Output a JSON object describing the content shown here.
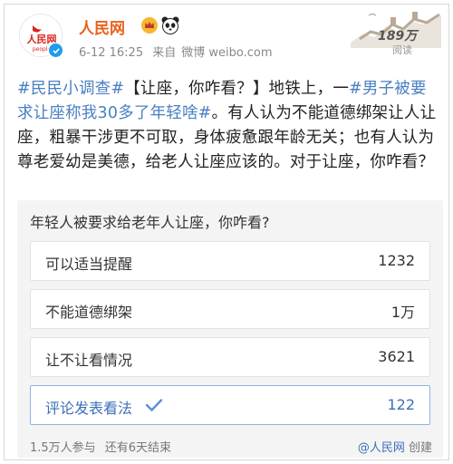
{
  "account": {
    "name": "人民网",
    "avatar_text": "人民网",
    "avatar_sub": "people",
    "badges": [
      "crown-badge-icon",
      "panda-badge-icon"
    ],
    "verified": true
  },
  "meta": {
    "time": "6-12 16:25",
    "source_prefix": "来自",
    "source": "微博 weibo.com"
  },
  "reads": {
    "count": "189万",
    "label": "阅读"
  },
  "post": {
    "tag1": "#民民小调查#",
    "t1": "【让座，你咋看？】地铁上，一",
    "tag2": "#男子被要求让座称我30多了年轻啥#",
    "t2": "。有人认为不能道德绑架让人让座，粗暴干涉更不可取，身体疲惫跟年龄无关；也有人认为尊老爱幼是美德，给老人让座应该的。对于让座，你咋看？"
  },
  "poll": {
    "question": "年轻人被要求给老年人让座，你咋看?",
    "options": [
      {
        "label": "可以适当提醒",
        "count": "1232",
        "selected": false
      },
      {
        "label": "不能道德绑架",
        "count": "1万",
        "selected": false
      },
      {
        "label": "让不让看情况",
        "count": "3621",
        "selected": false
      },
      {
        "label": "评论发表看法",
        "count": "122",
        "selected": true
      }
    ],
    "participants": "1.5万人参与",
    "remaining": "还有6天结束",
    "creator_prefix": "@",
    "creator": "人民网",
    "creator_suffix": "创建"
  },
  "colors": {
    "accent": "#3d6fb8",
    "name": "#e8611c",
    "hashtag": "#4a7fc1"
  }
}
